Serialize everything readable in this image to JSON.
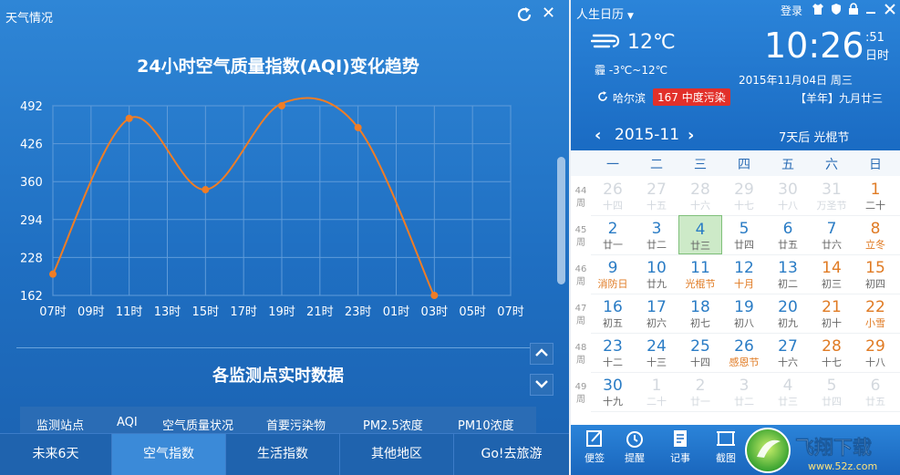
{
  "weather_panel": {
    "window_title": "天气情况",
    "chart_title": "24小时空气质量指数(AQI)变化趋势",
    "section_title": "各监测点实时数据",
    "table_headers": [
      "监测站点",
      "AQI",
      "空气质量状况",
      "首要污染物",
      "PM2.5浓度",
      "PM10浓度"
    ],
    "tabs": [
      {
        "label": "未来6天",
        "active": false
      },
      {
        "label": "空气指数",
        "active": true
      },
      {
        "label": "生活指数",
        "active": false
      },
      {
        "label": "其他地区",
        "active": false
      },
      {
        "label": "Go!去旅游",
        "active": false
      }
    ]
  },
  "chart_data": {
    "type": "line",
    "title": "24小时空气质量指数(AQI)变化趋势",
    "xlabel": "",
    "ylabel": "",
    "x_ticks": [
      "07时",
      "09时",
      "11时",
      "13时",
      "15时",
      "17时",
      "19时",
      "21时",
      "23时",
      "01时",
      "03时",
      "05时",
      "07时"
    ],
    "y_ticks": [
      162,
      228,
      294,
      360,
      426,
      492
    ],
    "ylim": [
      162,
      492
    ],
    "series": [
      {
        "color": "#f07d25",
        "points": [
          {
            "x": "07时",
            "y": 199
          },
          {
            "x": "11时",
            "y": 470
          },
          {
            "x": "15时",
            "y": 346
          },
          {
            "x": "19时",
            "y": 496
          },
          {
            "x": "23时",
            "y": 454
          },
          {
            "x": "03时",
            "y": 160
          }
        ]
      }
    ],
    "grid": true
  },
  "calendar": {
    "app_title": "人生日历",
    "login": "登录",
    "weather_temp": "12℃",
    "weather_range": "-3℃~12℃",
    "weather_prefix": "霾",
    "clock": "10:26",
    "seconds": ":51",
    "weekday_tag": "日时",
    "date": "2015年11月04日 周三",
    "city": "哈尔滨",
    "aqi_badge": "167 中度污染",
    "lunar": "【羊年】九月廿三",
    "month": "2015-11",
    "event": "7天后 光棍节",
    "weekdays": [
      "一",
      "二",
      "三",
      "四",
      "五",
      "六",
      "日"
    ],
    "weeks": [
      {
        "wk": "44",
        "label": "周",
        "days": [
          {
            "n": "26",
            "s": "十四",
            "other": true
          },
          {
            "n": "27",
            "s": "十五",
            "other": true
          },
          {
            "n": "28",
            "s": "十六",
            "other": true
          },
          {
            "n": "29",
            "s": "十七",
            "other": true
          },
          {
            "n": "30",
            "s": "十八",
            "other": true
          },
          {
            "n": "31",
            "s": "万圣节",
            "other": true
          },
          {
            "n": "1",
            "s": "二十",
            "color": "orange"
          }
        ]
      },
      {
        "wk": "45",
        "label": "周",
        "days": [
          {
            "n": "2",
            "s": "廿一"
          },
          {
            "n": "3",
            "s": "廿二"
          },
          {
            "n": "4",
            "s": "廿三",
            "today": true
          },
          {
            "n": "5",
            "s": "廿四"
          },
          {
            "n": "6",
            "s": "廿五"
          },
          {
            "n": "7",
            "s": "廿六"
          },
          {
            "n": "8",
            "s": "立冬",
            "color": "orange",
            "scolor": "orange"
          }
        ]
      },
      {
        "wk": "46",
        "label": "周",
        "days": [
          {
            "n": "9",
            "s": "消防日",
            "scolor": "orange"
          },
          {
            "n": "10",
            "s": "廿九"
          },
          {
            "n": "11",
            "s": "光棍节",
            "scolor": "orange"
          },
          {
            "n": "12",
            "s": "十月",
            "scolor": "orange"
          },
          {
            "n": "13",
            "s": "初二"
          },
          {
            "n": "14",
            "s": "初三",
            "color": "orange"
          },
          {
            "n": "15",
            "s": "初四",
            "color": "orange"
          }
        ]
      },
      {
        "wk": "47",
        "label": "周",
        "days": [
          {
            "n": "16",
            "s": "初五"
          },
          {
            "n": "17",
            "s": "初六"
          },
          {
            "n": "18",
            "s": "初七"
          },
          {
            "n": "19",
            "s": "初八"
          },
          {
            "n": "20",
            "s": "初九"
          },
          {
            "n": "21",
            "s": "初十",
            "color": "orange"
          },
          {
            "n": "22",
            "s": "小雪",
            "color": "orange",
            "scolor": "orange"
          }
        ]
      },
      {
        "wk": "48",
        "label": "周",
        "days": [
          {
            "n": "23",
            "s": "十二"
          },
          {
            "n": "24",
            "s": "十三"
          },
          {
            "n": "25",
            "s": "十四"
          },
          {
            "n": "26",
            "s": "感恩节",
            "scolor": "orange"
          },
          {
            "n": "27",
            "s": "十六"
          },
          {
            "n": "28",
            "s": "十七",
            "color": "orange"
          },
          {
            "n": "29",
            "s": "十八",
            "color": "orange"
          }
        ]
      },
      {
        "wk": "49",
        "label": "周",
        "days": [
          {
            "n": "30",
            "s": "十九"
          },
          {
            "n": "1",
            "s": "二十",
            "other": true
          },
          {
            "n": "2",
            "s": "廿一",
            "other": true
          },
          {
            "n": "3",
            "s": "廿二",
            "other": true
          },
          {
            "n": "4",
            "s": "廿三",
            "other": true
          },
          {
            "n": "5",
            "s": "廿四",
            "other": true
          },
          {
            "n": "6",
            "s": "廿五",
            "other": true
          }
        ]
      }
    ],
    "tools": [
      {
        "label": "便签",
        "icon": "note-icon"
      },
      {
        "label": "提醒",
        "icon": "alarm-clock-icon"
      },
      {
        "label": "记事",
        "icon": "notebook-icon"
      },
      {
        "label": "截图",
        "icon": "screenshot-icon"
      }
    ],
    "watermark": {
      "brand": "飞翔下载",
      "url": "www.52z.com"
    },
    "colors": {
      "accent": "#1a6bc3",
      "number_blue": "#2a7cc5",
      "weekend_orange": "#e07b24",
      "aqi_red": "#e2302a"
    }
  }
}
